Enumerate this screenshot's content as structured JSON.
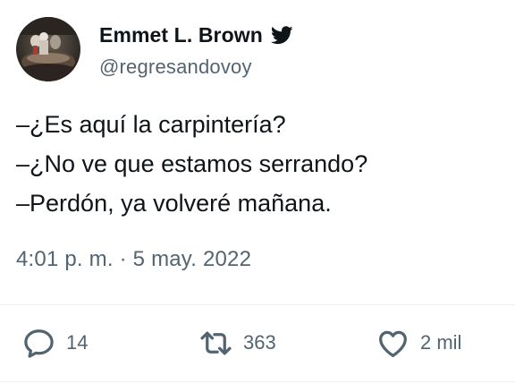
{
  "author": {
    "display_name": "Emmet L. Brown",
    "handle": "@regresandovoy",
    "verified_icon": "twitter-bird-icon"
  },
  "tweet": {
    "lines": [
      "–¿Es aquí la carpintería?",
      "–¿No ve que estamos serrando?",
      "–Perdón, ya volveré mañana."
    ],
    "timestamp": "4:01 p. m. · 5 may. 2022"
  },
  "actions": {
    "reply": {
      "icon": "reply-icon",
      "count": "14"
    },
    "retweet": {
      "icon": "retweet-icon",
      "count": "363"
    },
    "like": {
      "icon": "heart-icon",
      "count": "2 mil"
    }
  },
  "colors": {
    "text_primary": "#0f1419",
    "text_secondary": "#536471",
    "divider": "#eff3f4"
  }
}
